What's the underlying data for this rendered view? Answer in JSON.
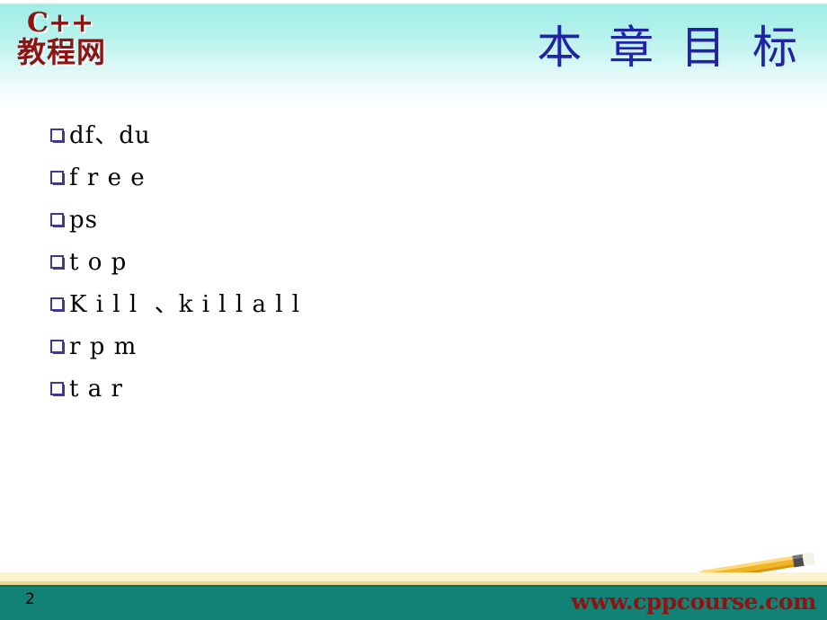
{
  "slide": {
    "title": "本 章 目 标",
    "logo": {
      "line1": "C++",
      "line2": "教程网",
      "color": "#8e1414"
    },
    "accent_colors": {
      "header_aqua": "#9fede6",
      "title_blue": "#2222a8",
      "bullet_blue": "#3b3b96",
      "footer_teal": "#128276",
      "footer_cream": "#fbf3cd",
      "footer_gold": "#e8d98a",
      "brand_red": "#8e1414"
    },
    "bullets": [
      {
        "label": "df、du"
      },
      {
        "label": "f r e e"
      },
      {
        "label": "ps"
      },
      {
        "label": "t o p"
      },
      {
        "label": "K i l l  、k i l l a l l"
      },
      {
        "label": "r p m"
      },
      {
        "label": "t a r"
      }
    ],
    "footer": {
      "page_number": "2",
      "site_url": "www.cppcourse.com",
      "pencil_icon": "pencil-icon"
    }
  }
}
